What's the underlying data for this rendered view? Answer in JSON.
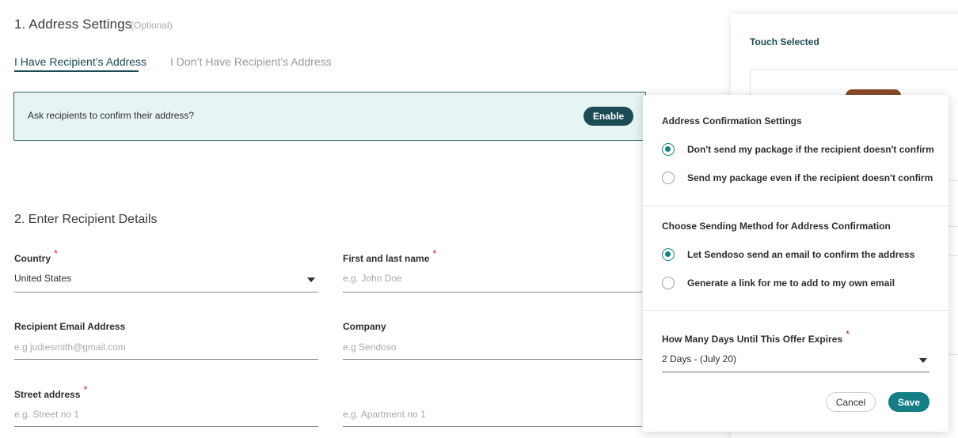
{
  "address_settings": {
    "title": "1. Address Settings",
    "optional_label": "(Optional)",
    "tabs": [
      {
        "label": "I Have Recipient’s Address",
        "active": true
      },
      {
        "label": "I Don’t Have Recipient’s Address",
        "active": false
      }
    ],
    "confirm_prompt": "Ask recipients to confirm their address?",
    "enable_label": "Enable"
  },
  "recipient_details": {
    "title": "2. Enter Recipient Details",
    "required_marker": "*",
    "country": {
      "label": "Country",
      "value": "United States"
    },
    "name": {
      "label": "First and last name",
      "placeholder": "e.g. John Doe"
    },
    "email": {
      "label": "Recipient Email Address",
      "placeholder": "e.g judiesmith@gmail.com"
    },
    "company": {
      "label": "Company",
      "placeholder": "e.g Sendoso"
    },
    "street": {
      "label": "Street address",
      "placeholder": "e.g. Street no 1"
    },
    "apartment": {
      "placeholder": "e.g. Apartment no 1"
    }
  },
  "summary_panel": {
    "title": "Touch Selected"
  },
  "popover": {
    "confirmation_heading": "Address Confirmation Settings",
    "confirmation_options": [
      {
        "label": "Don't send my package if the recipient doesn't confirm",
        "checked": true
      },
      {
        "label": "Send my package even if the recipient doesn't confirm",
        "checked": false
      }
    ],
    "method_heading": "Choose Sending Method for Address Confirmation",
    "method_options": [
      {
        "label": "Let Sendoso send an email to confirm the address",
        "checked": true
      },
      {
        "label": "Generate a link for me to add to my own email",
        "checked": false
      }
    ],
    "expiry_label": "How Many Days Until This Offer Expires",
    "expiry_value": "2 Days - (July 20)",
    "cancel_label": "Cancel",
    "save_label": "Save"
  },
  "colors": {
    "primary_dark": "#1c4a55",
    "accent_teal": "#137f85",
    "info_bg": "#e6f4f4",
    "required_red": "#c0282d"
  }
}
